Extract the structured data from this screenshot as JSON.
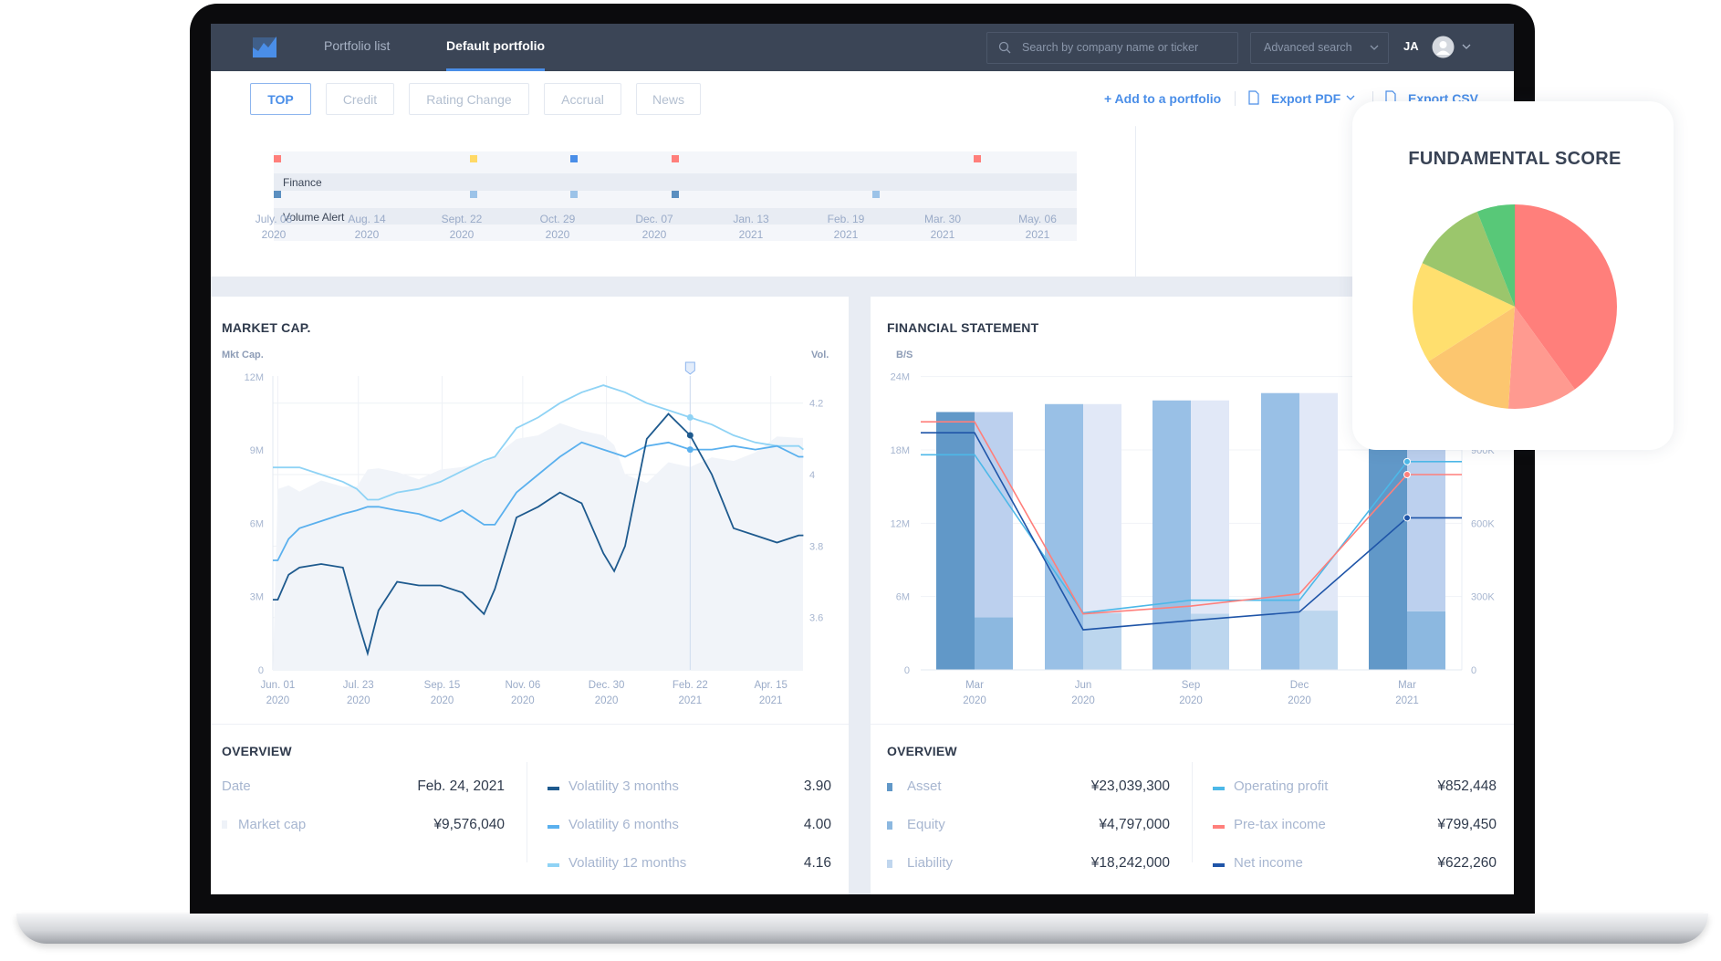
{
  "nav": {
    "links": [
      "Portfolio list",
      "Default portfolio"
    ],
    "active_link": "Default portfolio",
    "search_placeholder": "Search by company name or ticker",
    "advanced_search": "Advanced search",
    "user_initials": "JA",
    "accent": "#4a8ee8"
  },
  "toolbar": {
    "tabs": [
      "TOP",
      "Credit",
      "Rating Change",
      "Accrual",
      "News"
    ],
    "active_tab": "TOP",
    "add_to_portfolio": "+ Add to a portfolio",
    "export_pdf": "Export PDF",
    "export_csv": "Export CSV"
  },
  "timeline": {
    "rows": [
      {
        "label": "",
        "markers": [
          {
            "date": "July. 08 2020",
            "color": "#ff7f7b"
          },
          {
            "date": "Sept. 22 2020",
            "color": "#ffd966"
          },
          {
            "date": "Oct. 29 2020",
            "color": "#4a8ee8"
          },
          {
            "date": "Dec. 07 2020",
            "color": "#ff7f7b"
          },
          {
            "date": "Apr. 20 2021",
            "color": "#ff7f7b"
          }
        ]
      },
      {
        "label": "Finance",
        "markers": [
          {
            "date": "July. 08 2020",
            "color": "#5b8fc0"
          },
          {
            "date": "Sept. 22 2020",
            "color": "#9cc3e8"
          },
          {
            "date": "Oct. 29 2020",
            "color": "#9cc3e8"
          },
          {
            "date": "Dec. 07 2020",
            "color": "#5b8fc0"
          },
          {
            "date": "Feb. 26 2021",
            "color": "#9cc3e8"
          }
        ]
      },
      {
        "label": "Volume Alert",
        "markers": []
      }
    ],
    "dates": [
      {
        "day": "July. 08",
        "year": "2020"
      },
      {
        "day": "Aug. 14",
        "year": "2020"
      },
      {
        "day": "Sept. 22",
        "year": "2020"
      },
      {
        "day": "Oct. 29",
        "year": "2020"
      },
      {
        "day": "Dec. 07",
        "year": "2020"
      },
      {
        "day": "Jan. 13",
        "year": "2021"
      },
      {
        "day": "Feb. 19",
        "year": "2021"
      },
      {
        "day": "Mar. 30",
        "year": "2021"
      },
      {
        "day": "May. 06",
        "year": "2021"
      }
    ]
  },
  "market": {
    "title": "MARKET CAP.",
    "overview_title": "OVERVIEW",
    "overview": {
      "date_label": "Date",
      "date_value": "Feb. 24, 2021",
      "cap_label": "Market cap",
      "cap_value": "¥9,576,040",
      "vols": [
        {
          "label": "Volatility 3 months",
          "value": "3.90",
          "color": "#1e5a8e"
        },
        {
          "label": "Volatility 6 months",
          "value": "4.00",
          "color": "#5ab0ee"
        },
        {
          "label": "Volatility 12 months",
          "value": "4.16",
          "color": "#8fd3f5"
        }
      ]
    }
  },
  "financial": {
    "title": "FINANCIAL STATEMENT",
    "overview_title": "OVERVIEW",
    "overview": {
      "bs": [
        {
          "label": "Asset",
          "value": "¥23,039,300",
          "color": "#6198c8"
        },
        {
          "label": "Equity",
          "value": "¥4,797,000",
          "color": "#8cb8e0"
        },
        {
          "label": "Liability",
          "value": "¥18,242,000",
          "color": "#c0d6ee"
        }
      ],
      "pl": [
        {
          "label": "Operating profit",
          "value": "¥852,448",
          "color": "#4db8e8"
        },
        {
          "label": "Pre-tax income",
          "value": "¥799,450",
          "color": "#ff7f7b"
        },
        {
          "label": "Net income",
          "value": "¥622,260",
          "color": "#1f55a8"
        }
      ]
    }
  },
  "score_card": {
    "title": "FUNDAMENTAL SCORE"
  },
  "chart_data": [
    {
      "type": "line",
      "ylabel": "Mkt Cap.",
      "y2label": "Vol.",
      "ylim": [
        0,
        12
      ],
      "yticks": [
        "0",
        "3M",
        "6M",
        "9M",
        "12M"
      ],
      "y2lim": [
        3.6,
        4.2
      ],
      "y2ticks": [
        "3.6",
        "3.8",
        "4",
        "4.2"
      ],
      "xticks": [
        {
          "date": "2020-06-01",
          "day": "Jun. 01",
          "year": "2020"
        },
        {
          "date": "2020-07-23",
          "day": "Jul. 23",
          "year": "2020"
        },
        {
          "date": "2020-09-15",
          "day": "Sep. 15",
          "year": "2020"
        },
        {
          "date": "2020-11-06",
          "day": "Nov. 06",
          "year": "2020"
        },
        {
          "date": "2020-12-30",
          "day": "Dec. 30",
          "year": "2020"
        },
        {
          "date": "2021-02-22",
          "day": "Feb. 22",
          "year": "2021"
        },
        {
          "date": "2021-04-15",
          "day": "Apr. 15",
          "year": "2021"
        }
      ],
      "cursor_date": "2021-02-22",
      "x": [
        "2020-06-01",
        "2020-06-08",
        "2020-06-15",
        "2020-06-29",
        "2020-07-13",
        "2020-07-22",
        "2020-07-29",
        "2020-08-05",
        "2020-08-17",
        "2020-08-31",
        "2020-09-14",
        "2020-09-28",
        "2020-10-12",
        "2020-10-19",
        "2020-11-02",
        "2020-11-16",
        "2020-11-30",
        "2020-12-14",
        "2020-12-28",
        "2021-01-04",
        "2021-01-11",
        "2021-01-25",
        "2021-02-08",
        "2021-02-22",
        "2021-03-08",
        "2021-03-22",
        "2021-04-05",
        "2021-04-19",
        "2021-05-03",
        "2021-05-06"
      ],
      "area": {
        "name": "Market cap",
        "axis": "left",
        "unit": "M",
        "color": "#f1f4f9",
        "values": [
          7.4,
          7.55,
          7.3,
          7.75,
          7.5,
          7.5,
          8.2,
          8.25,
          8.1,
          7.8,
          8.2,
          8.3,
          8.5,
          8.75,
          9.45,
          9.6,
          10.1,
          9.8,
          9.6,
          9.2,
          8.0,
          7.65,
          8.5,
          8.3,
          8.7,
          8.55,
          8.9,
          9.55,
          9.5,
          9.5
        ]
      },
      "series": [
        {
          "name": "Volatility 12 months",
          "axis": "right",
          "color": "#8fd3f5",
          "values": [
            4.02,
            4.02,
            4.02,
            4.0,
            3.98,
            3.96,
            3.93,
            3.93,
            3.95,
            3.96,
            3.98,
            4.01,
            4.04,
            4.05,
            4.13,
            4.16,
            4.2,
            4.23,
            4.25,
            4.24,
            4.23,
            4.2,
            4.18,
            4.16,
            4.14,
            4.11,
            4.09,
            4.08,
            4.08,
            4.07
          ]
        },
        {
          "name": "Volatility 6 months",
          "axis": "right",
          "color": "#5ab0ee",
          "values": [
            3.76,
            3.82,
            3.85,
            3.87,
            3.89,
            3.9,
            3.91,
            3.91,
            3.9,
            3.89,
            3.87,
            3.9,
            3.86,
            3.86,
            3.95,
            4.0,
            4.05,
            4.09,
            4.07,
            4.06,
            4.05,
            4.08,
            4.09,
            4.07,
            4.07,
            4.08,
            4.07,
            4.08,
            4.05,
            4.05
          ]
        },
        {
          "name": "Volatility 3 months",
          "axis": "right",
          "color": "#1e5a8e",
          "values": [
            3.65,
            3.72,
            3.74,
            3.75,
            3.74,
            3.6,
            3.5,
            3.62,
            3.7,
            3.69,
            3.69,
            3.67,
            3.61,
            3.68,
            3.88,
            3.91,
            3.95,
            3.92,
            3.78,
            3.73,
            3.8,
            4.1,
            4.17,
            4.11,
            4.0,
            3.85,
            3.83,
            3.81,
            3.83,
            3.83
          ]
        }
      ]
    },
    {
      "type": "bar",
      "ylabel": "B/S",
      "ylim": [
        0,
        24
      ],
      "yticks": [
        "0",
        "6M",
        "12M",
        "18M",
        "24M"
      ],
      "y2lim": [
        0,
        900
      ],
      "y2ticks": [
        "0",
        "300K",
        "600K",
        "900K"
      ],
      "categories": [
        {
          "month": "Mar",
          "year": "2020"
        },
        {
          "month": "Jun",
          "year": "2020"
        },
        {
          "month": "Sep",
          "year": "2020"
        },
        {
          "month": "Dec",
          "year": "2020"
        },
        {
          "month": "Mar",
          "year": "2021"
        }
      ],
      "emphasized": [
        true,
        false,
        false,
        false,
        true
      ],
      "bars": {
        "Asset": [
          21.1,
          21.75,
          22.05,
          22.65,
          23.04
        ],
        "Equity": [
          4.3,
          4.65,
          4.6,
          4.85,
          4.797
        ],
        "Liability": [
          16.8,
          17.1,
          17.45,
          17.8,
          18.242
        ]
      },
      "bar_colors": {
        "emphasized": [
          "#6198c8",
          "#8cb8e0",
          "#bcd0ee"
        ],
        "normal": [
          "#99c0e6",
          "#bcd6ee",
          "#e1e8f7"
        ]
      },
      "series": [
        {
          "name": "Operating profit",
          "unit": "K",
          "color": "#4db8e8",
          "values": [
            880,
            233,
            285,
            285,
            852
          ]
        },
        {
          "name": "Pre-tax income",
          "unit": "K",
          "color": "#ff7f7b",
          "values": [
            1015,
            229,
            261,
            311,
            799
          ]
        },
        {
          "name": "Net income",
          "unit": "K",
          "color": "#1f55a8",
          "values": [
            970,
            164,
            202,
            237,
            622
          ]
        }
      ]
    },
    {
      "type": "pie",
      "title": "FUNDAMENTAL SCORE",
      "values": [
        40,
        11,
        15,
        16,
        12,
        6
      ],
      "colors": [
        "#ff7f7b",
        "#ff9a90",
        "#fcc66f",
        "#ffdf6e",
        "#9bc66c",
        "#58c878"
      ]
    }
  ]
}
